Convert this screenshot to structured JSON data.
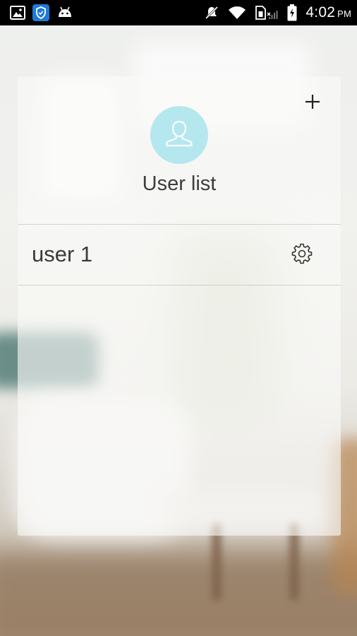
{
  "status_bar": {
    "time": "4:02",
    "ampm": "PM",
    "icons": [
      "gallery-icon",
      "shield-app-icon",
      "android-debug-icon",
      "mute-icon",
      "wifi-icon",
      "sim-no-signal-icon",
      "battery-charging-icon"
    ]
  },
  "user_list": {
    "title": "User list",
    "add_icon": "plus-icon",
    "avatar_icon": "user-silhouette-icon",
    "users": [
      {
        "name": "user 1",
        "action_icon": "gear-icon"
      }
    ]
  },
  "colors": {
    "avatar_bg": "#b5e7ef",
    "status_bar_bg": "#000000",
    "text": "#3d3d3d"
  }
}
